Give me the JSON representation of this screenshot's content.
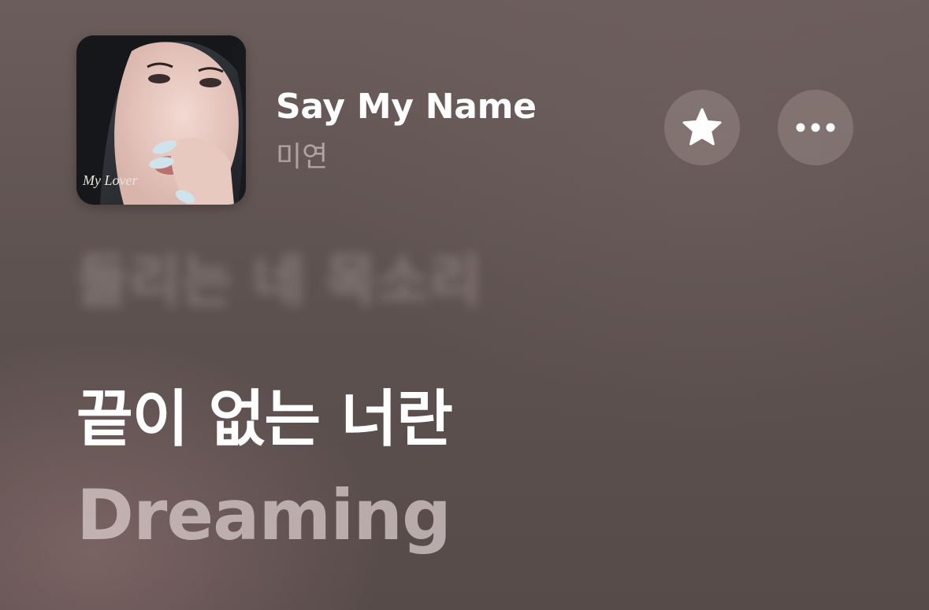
{
  "now_playing": {
    "album_art_text": "My Lover",
    "title": "Say My Name",
    "artist": "미연"
  },
  "actions": {
    "favorite_icon": "star-icon",
    "more_icon": "ellipsis-icon"
  },
  "lyrics": {
    "previous_line": "들리는 네 목소리",
    "current_line": "끝이 없는 너란",
    "next_line": "Dreaming"
  },
  "colors": {
    "background": "#5e5250",
    "button_fill": "#968785",
    "text_primary": "#ffffff",
    "text_secondary": "#d8ccca"
  }
}
